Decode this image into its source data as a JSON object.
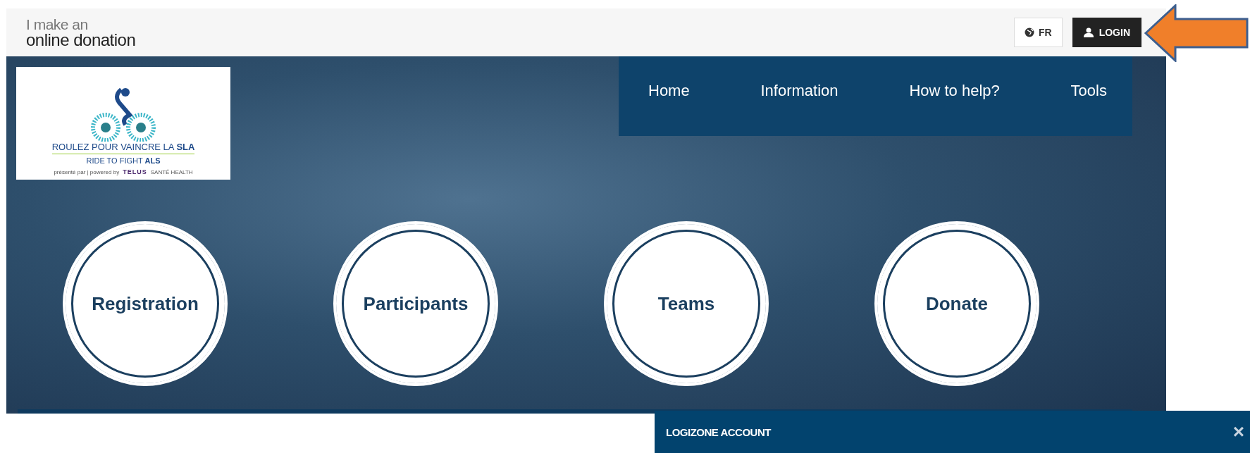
{
  "header": {
    "brand": {
      "line_1": "I make an",
      "line_2": "online donation"
    },
    "language_button": "FR",
    "login_button": "LOGIN"
  },
  "event_logo": {
    "title_fr": "ROULEZ POUR VAINCRE LA **SLA**",
    "title_en": "RIDE TO FIGHT **ALS**",
    "presented_by": "présenté par | powered by",
    "sponsor": "TELUS",
    "sponsor_sub": "SANTÉ HEALTH"
  },
  "nav": {
    "items": [
      {
        "label": "Home"
      },
      {
        "label": "Information"
      },
      {
        "label": "How to help?"
      },
      {
        "label": "Tools"
      }
    ]
  },
  "actions": [
    {
      "label": "Registration"
    },
    {
      "label": "Participants"
    },
    {
      "label": "Teams"
    },
    {
      "label": "Donate"
    }
  ],
  "account_panel": {
    "title": "LOGIZONE ACCOUNT",
    "close": "×"
  }
}
